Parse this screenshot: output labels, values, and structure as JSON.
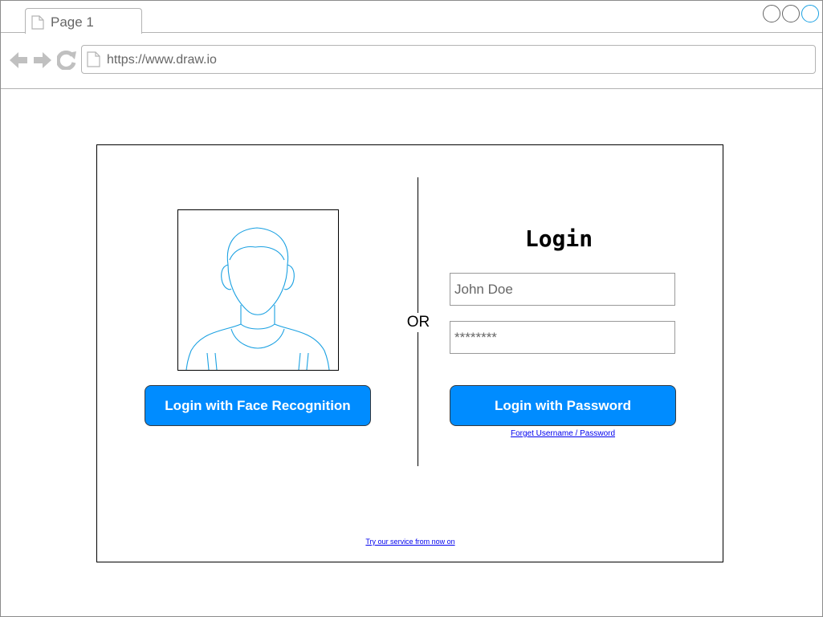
{
  "browser": {
    "tab_label": "Page 1",
    "url": "https://www.draw.io"
  },
  "login": {
    "title": "Login",
    "separator": "OR",
    "face_button_label": "Login with Face Recognition",
    "password_button_label": "Login with Password",
    "username_value": "John Doe",
    "password_value": "********",
    "forget_link": "Forget Username / Password",
    "try_link": "Try our service from now on"
  },
  "colors": {
    "primary_button": "#008cff",
    "avatar_stroke": "#1ba1e2",
    "link": "#0000ee"
  },
  "icons": {
    "tab": "page-icon",
    "back": "arrow-left-icon",
    "forward": "arrow-right-icon",
    "reload": "reload-icon",
    "url": "page-icon",
    "avatar": "user-avatar-icon"
  }
}
